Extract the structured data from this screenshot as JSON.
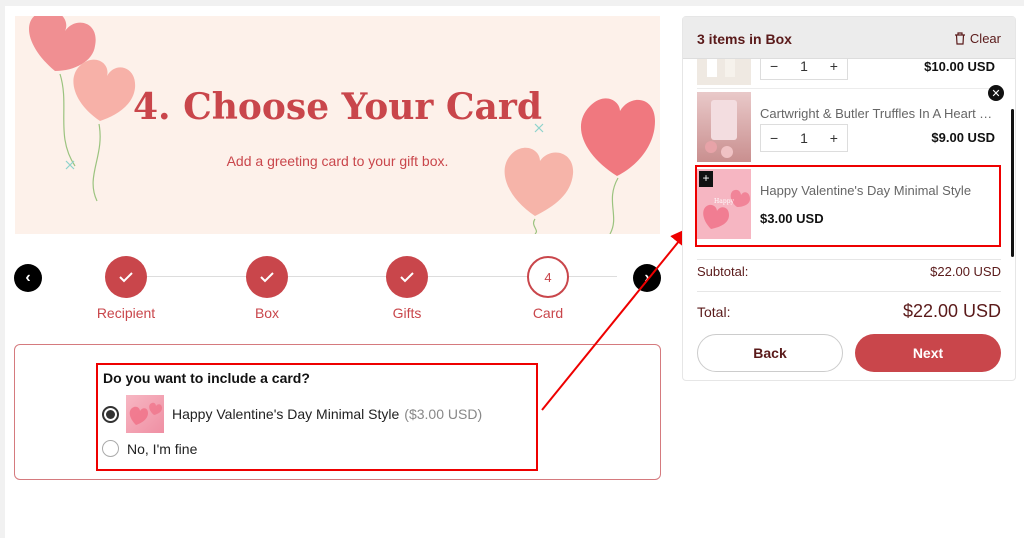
{
  "banner": {
    "title": "4. Choose Your Card",
    "subtitle": "Add a greeting card to your gift box."
  },
  "steps": [
    {
      "label": "Recipient",
      "state": "done"
    },
    {
      "label": "Box",
      "state": "done"
    },
    {
      "label": "Gifts",
      "state": "done"
    },
    {
      "label": "Card",
      "state": "current",
      "number": "4"
    }
  ],
  "card_question": {
    "question": "Do you want to include a card?",
    "options": [
      {
        "label": "Happy Valentine's Day Minimal Style",
        "price": "($3.00 USD)",
        "selected": true
      },
      {
        "label": "No, I'm fine",
        "selected": false
      }
    ]
  },
  "sidebar": {
    "title": "3 items in Box",
    "clear_label": "Clear",
    "items": [
      {
        "name": "",
        "qty": "1",
        "price": "$10.00 USD"
      },
      {
        "name": "Cartwright & Butler Truffles In A Heart Tin",
        "qty": "1",
        "price": "$9.00 USD"
      },
      {
        "name": "Happy Valentine's Day Minimal Style",
        "price": "$3.00 USD"
      }
    ],
    "subtotal_label": "Subtotal:",
    "subtotal_value": "$22.00 USD",
    "total_label": "Total:",
    "total_value": "$22.00 USD",
    "back_label": "Back",
    "next_label": "Next"
  },
  "colors": {
    "accent": "#c9464b",
    "annotation": "#e00000"
  }
}
